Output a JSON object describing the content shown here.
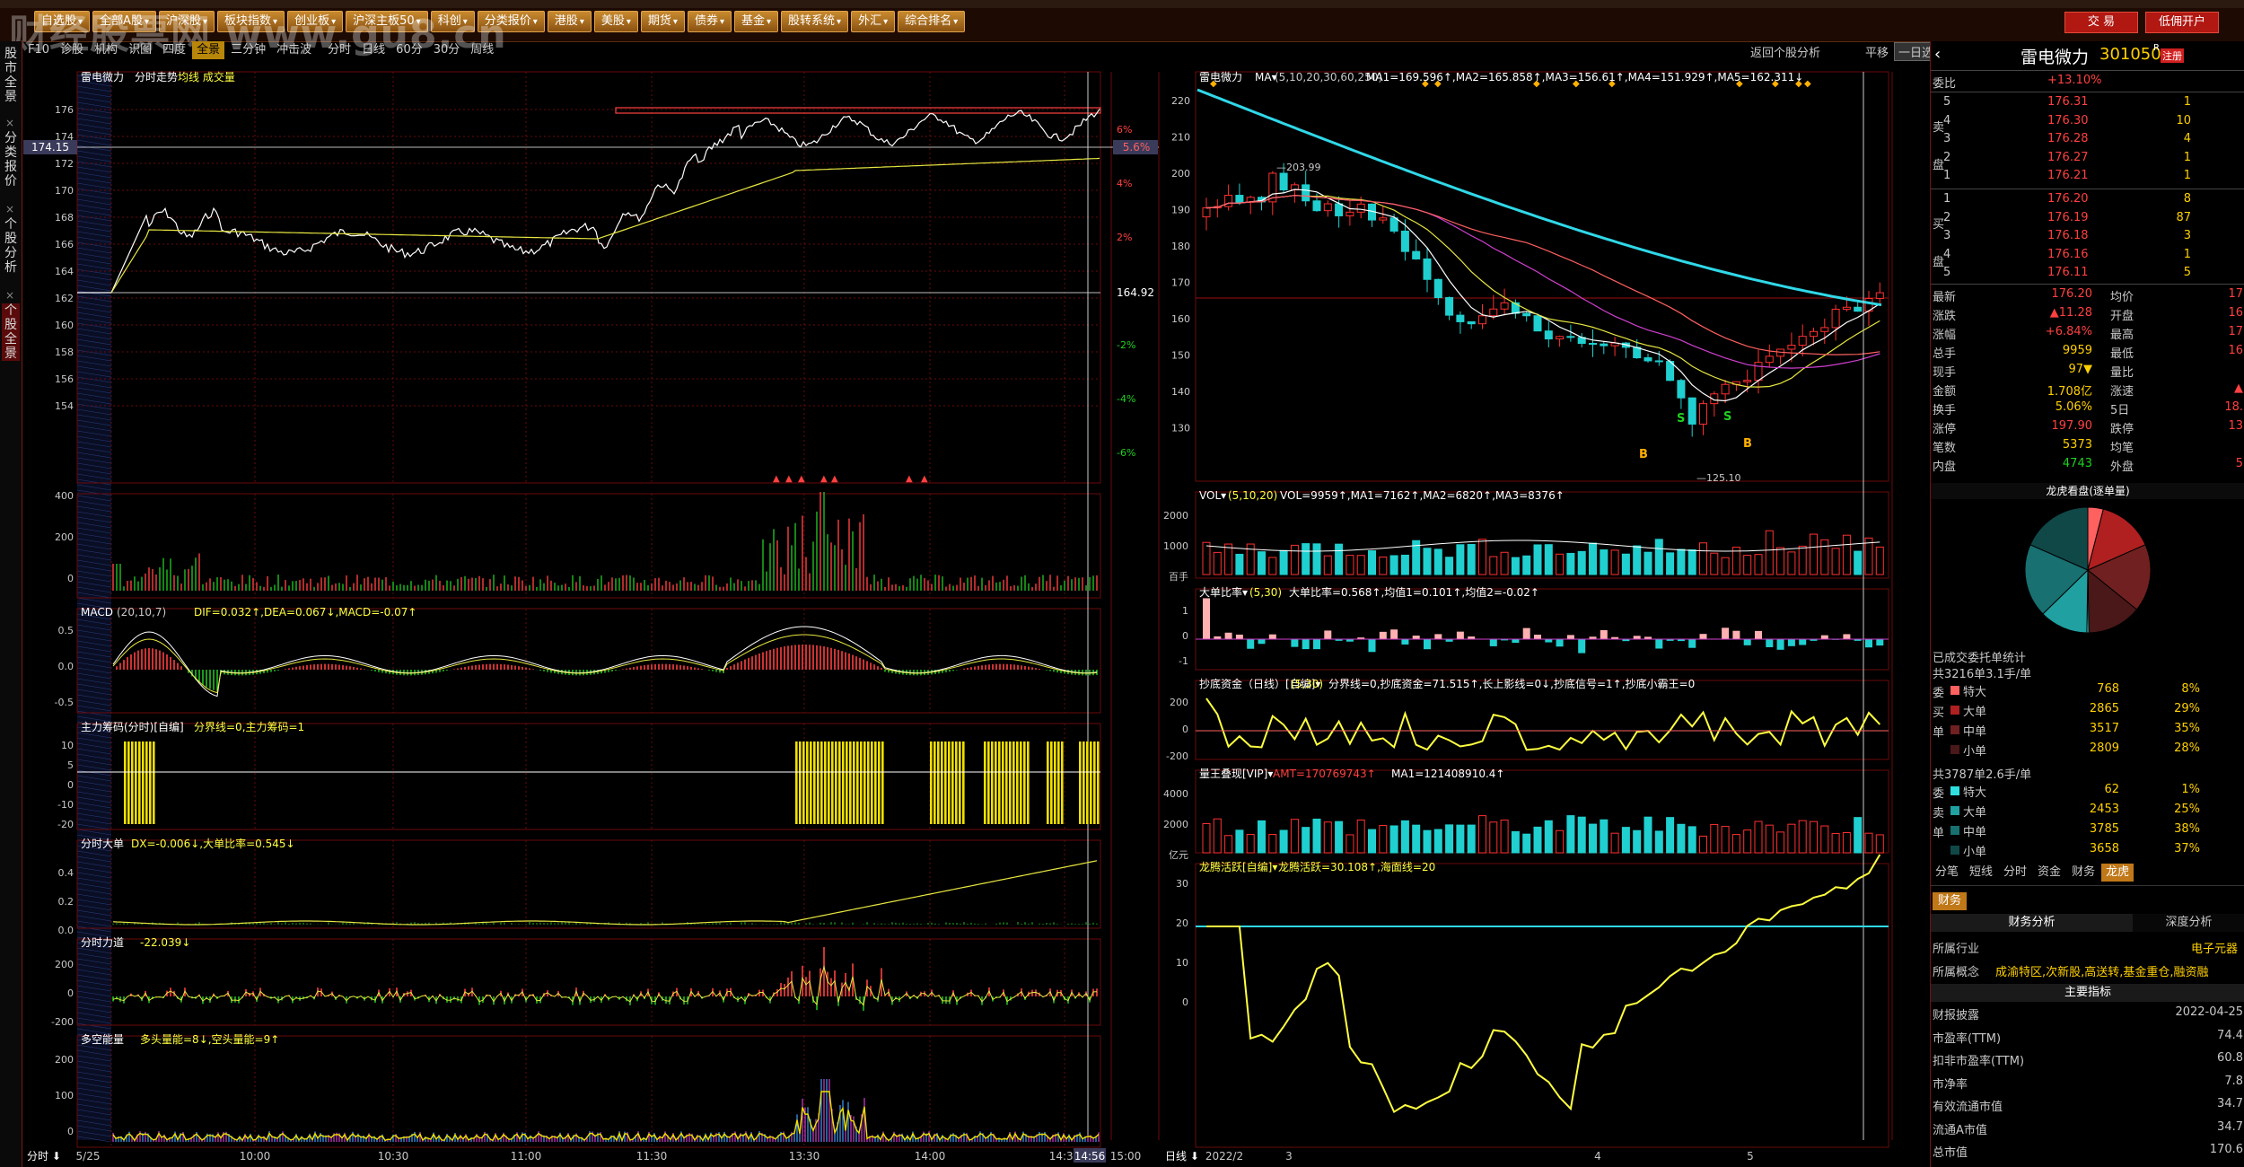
{
  "title_watermark": "财经股票网 www.gu8.cn",
  "menu": [
    {
      "label": "自选股"
    },
    {
      "label": "全部A股"
    },
    {
      "label": "沪深股"
    },
    {
      "label": "板块指数"
    },
    {
      "label": "创业板"
    },
    {
      "label": "沪深主板50"
    },
    {
      "label": "科创"
    },
    {
      "label": "分类报价"
    },
    {
      "label": "港股"
    },
    {
      "label": "美股"
    },
    {
      "label": "期货"
    },
    {
      "label": "债券"
    },
    {
      "label": "基金"
    },
    {
      "label": "股转系统"
    },
    {
      "label": "外汇"
    },
    {
      "label": "综合排名"
    }
  ],
  "top_right_buttons": {
    "trade": "交 易",
    "open_account": "低佣开户"
  },
  "sidebar": [
    "股市全景",
    "分类报价",
    "个股分析",
    "个股全景"
  ],
  "subtabs": [
    "F10",
    "诊股",
    "机构",
    "识图",
    "四度",
    "全景",
    "三分钟",
    "冲击波",
    "分时",
    "日线",
    "60分",
    "30分",
    "周线"
  ],
  "right_toolbar": {
    "back": "返回个股分析",
    "flat": "平移",
    "range": "一日选"
  },
  "left_panels": {
    "intraday_title": "雷电微力",
    "intraday_mode": "分时走势",
    "intraday_overlays": "均线 成交量",
    "price_axis": [
      "176",
      "174",
      "172",
      "170",
      "168",
      "166",
      "164",
      "162",
      "160",
      "158",
      "156",
      "154"
    ],
    "current_price_label": "174.15",
    "pct_axis": [
      "6%",
      "4%",
      "2%",
      "-2%",
      "-4%",
      "-6%"
    ],
    "pct_current": "5.6%",
    "prev_close_label": "164.92",
    "vol_axis": [
      "400",
      "200",
      "0"
    ],
    "macd_title": "MACD",
    "macd_params": "(20,10,7)",
    "macd_values": "DIF=0.032↑,DEA=0.067↓,MACD=-0.07↑",
    "macd_axis": [
      "0.5",
      "0.0",
      "-0.5"
    ],
    "zljm_title": "主力筹码(分时)[自编]",
    "zljm_values": "分界线=0,主力筹码=1",
    "zljm_axis": [
      "10",
      "5",
      "0",
      "-10",
      "-20"
    ],
    "fsdd_title": "分时大单",
    "fsdd_values": "DX=-0.006↓,大单比率=0.545↓",
    "fsdd_axis": [
      "0.4",
      "0.2",
      "0.0"
    ],
    "fsld_title": "分时力道",
    "fsld_values": "-22.039↓",
    "fsld_axis": [
      "200",
      "0",
      "-200"
    ],
    "dkl_title": "多空能量",
    "dkl_values": "多头量能=8↓,空头量能=9↑",
    "dkl_axis": [
      "200",
      "100",
      "0"
    ],
    "time_axis": [
      "5/25",
      "10:00",
      "10:30",
      "11:00",
      "11:30",
      "13:30",
      "14:00",
      "14:30",
      "14:56",
      "15:00"
    ],
    "time_mode": "分时"
  },
  "daily_panels": {
    "title": "雷电微力",
    "ma_label": "MA",
    "ma_params": "(5,10,20,30,60,250)",
    "ma_values": "MA1=169.596↑,MA2=165.858↑,MA3=156.61↑,MA4=151.929↑,MA5=162.311↓",
    "price_axis": [
      "220",
      "210",
      "200",
      "190",
      "180",
      "170",
      "160",
      "150",
      "140",
      "130"
    ],
    "high_label": "203.99",
    "low_label": "125.10",
    "vol_title": "VOL",
    "vol_params": "(5,10,20)",
    "vol_values": "VOL=9959↑,MA1=7162↑,MA2=6820↑,MA3=8376↑",
    "vol_axis": [
      "2000",
      "1000",
      "百手"
    ],
    "ddbl_title": "大单比率",
    "ddbl_params": "(5,30)",
    "ddbl_values": "大单比率=0.568↑,均值1=0.101↑,均值2=-0.02↑",
    "ddbl_axis": [
      "1",
      "0",
      "-1"
    ],
    "cdzj_title": "抄底资金（日线）[自编]",
    "cdzj_params": "(5,30)",
    "cdzj_values": "分界线=0,抄底资金=71.515↑,长上影线=0↓,抄底信号=1↑,抄底小霸王=0",
    "cdzj_axis": [
      "200",
      "0",
      "-200"
    ],
    "lwxq_title": "量王叠现[VIP]",
    "lwxq_amt": "AMT=170769743↑",
    "lwxq_ma": "MA1=121408910.4↑",
    "lwxq_axis": [
      "4000",
      "2000",
      "亿元"
    ],
    "lthy_title": "龙腾活跃[自编]",
    "lthy_values": "龙腾活跃=30.108↑,海面线=20",
    "lthy_axis": [
      "30",
      "20",
      "10",
      "0"
    ],
    "time_axis": [
      "2022/2",
      "3",
      "4",
      "5"
    ],
    "time_mode": "日线"
  },
  "stock": {
    "name": "雷电微力",
    "code": "301050",
    "badge": "R",
    "margin": "注册"
  },
  "order_book": {
    "ratio_label": "委比",
    "ratio_value": "+13.10%",
    "asks": [
      {
        "level": "5",
        "price": "176.31",
        "vol": "1"
      },
      {
        "level": "4",
        "price": "176.30",
        "vol": "10"
      },
      {
        "level": "3",
        "price": "176.28",
        "vol": "4"
      },
      {
        "level": "2",
        "price": "176.27",
        "vol": "1"
      },
      {
        "level": "1",
        "price": "176.21",
        "vol": "1"
      }
    ],
    "bids": [
      {
        "level": "1",
        "price": "176.20",
        "vol": "8"
      },
      {
        "level": "2",
        "price": "176.19",
        "vol": "87"
      },
      {
        "level": "3",
        "price": "176.18",
        "vol": "3"
      },
      {
        "level": "4",
        "price": "176.16",
        "vol": "1"
      },
      {
        "level": "5",
        "price": "176.11",
        "vol": "5"
      }
    ],
    "ask_side_label": "卖盘",
    "bid_side_label": "买盘"
  },
  "quote": [
    {
      "l": "最新",
      "v": "176.20",
      "l2": "均价",
      "v2": "17"
    },
    {
      "l": "涨跌",
      "v": "▲11.28",
      "l2": "开盘",
      "v2": "16"
    },
    {
      "l": "涨幅",
      "v": "+6.84%",
      "l2": "最高",
      "v2": "17"
    },
    {
      "l": "总手",
      "v": "9959",
      "l2": "最低",
      "v2": "16"
    },
    {
      "l": "现手",
      "v": "97▼",
      "l2": "量比",
      "v2": ""
    },
    {
      "l": "金额",
      "v": "1.708亿",
      "l2": "涨速",
      "v2": "▲"
    },
    {
      "l": "换手",
      "v": "5.06%",
      "l2": "5日",
      "v2": "18."
    },
    {
      "l": "涨停",
      "v": "197.90",
      "l2": "跌停",
      "v2": "13"
    },
    {
      "l": "笔数",
      "v": "5373",
      "l2": "均笔",
      "v2": ""
    },
    {
      "l": "内盘",
      "v": "4743",
      "l2": "外盘",
      "v2": "5"
    }
  ],
  "pie_title": "龙虎看盘(逐单量)",
  "orders_title": "已成交委托单统计",
  "buy_stats": {
    "header": "共3216单3.1手/单",
    "side": "委买单",
    "rows": [
      {
        "label": "特大",
        "count": "768",
        "pct": "8%"
      },
      {
        "label": "大单",
        "count": "2865",
        "pct": "29%"
      },
      {
        "label": "中单",
        "count": "3517",
        "pct": "35%"
      },
      {
        "label": "小单",
        "count": "2809",
        "pct": "28%"
      }
    ]
  },
  "sell_stats": {
    "header": "共3787单2.6手/单",
    "side": "委卖单",
    "rows": [
      {
        "label": "特大",
        "count": "62",
        "pct": "1%"
      },
      {
        "label": "大单",
        "count": "2453",
        "pct": "25%"
      },
      {
        "label": "中单",
        "count": "3785",
        "pct": "38%"
      },
      {
        "label": "小单",
        "count": "3658",
        "pct": "37%"
      }
    ]
  },
  "bottom_tabs": [
    "分笔",
    "短线",
    "分时",
    "资金",
    "财务",
    "龙虎"
  ],
  "finance": {
    "tab": "财务",
    "sub_tabs": [
      "财务分析",
      "深度分析"
    ],
    "industry_label": "所属行业",
    "industry_value": "电子元器",
    "concept_label": "所属概念",
    "concept_value": "成渝特区,次新股,高送转,基金重仓,融资融",
    "indicator_header": "主要指标",
    "rows": [
      {
        "l": "财报披露",
        "v": "2022-04-25"
      },
      {
        "l": "市盈率(TTM)",
        "v": "74.4"
      },
      {
        "l": "扣非市盈率(TTM)",
        "v": "60.8"
      },
      {
        "l": "市净率",
        "v": "7.8"
      },
      {
        "l": "有效流通市值",
        "v": "34.7"
      },
      {
        "l": "流通A市值",
        "v": "34.7"
      },
      {
        "l": "总市值",
        "v": "170.6"
      }
    ]
  },
  "colors": {
    "up": "#ff3030",
    "down": "#20d0d0",
    "green": "#20c020",
    "yellow": "#ffff00",
    "grid": "#6a0a0a",
    "ma250": "#30d8e8"
  }
}
